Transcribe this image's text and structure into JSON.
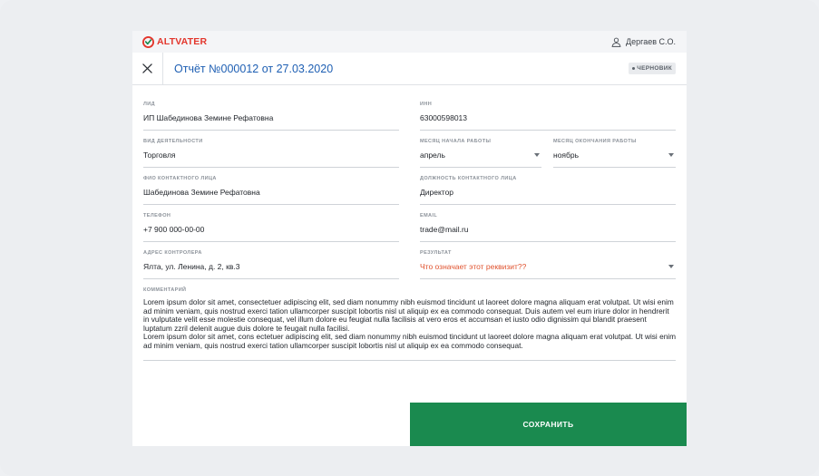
{
  "brand": {
    "name": "ALTVATER",
    "color": "#e3362c"
  },
  "user": {
    "name": "Дергаев С.О.",
    "icon": "user-icon"
  },
  "header": {
    "title": "Отчёт №000012 от 27.03.2020",
    "status_badge": "ЧЕРНОВИК",
    "close_icon": "close-icon"
  },
  "form": {
    "lid": {
      "label": "ЛИД",
      "value": "ИП Шабединова Земине Рефатовна"
    },
    "inn": {
      "label": "ИНН",
      "value": "63000598013"
    },
    "activity": {
      "label": "ВИД ДЕЯТЕЛЬНОСТИ",
      "value": "Торговля"
    },
    "start_month": {
      "label": "МЕСЯЦ НАЧАЛА РАБОТЫ",
      "value": "апрель"
    },
    "end_month": {
      "label": "МЕСЯЦ ОКОНЧАНИЯ РАБОТЫ",
      "value": "ноябрь"
    },
    "contact_name": {
      "label": "ФИО КОНТАКТНОГО ЛИЦА",
      "value": "Шабединова Земине Рефатовна"
    },
    "contact_position": {
      "label": "ДОЛЖНОСТЬ КОНТАКТНОГО ЛИЦА",
      "value": "Директор"
    },
    "phone": {
      "label": "ТЕЛЕФОН",
      "value": "+7 900 000-00-00"
    },
    "email": {
      "label": "EMAIL",
      "value": "trade@mail.ru"
    },
    "address": {
      "label": "АДРЕС КОНТРОЛЕРА",
      "value": "Ялта, ул. Ленина, д. 2, кв.3"
    },
    "result": {
      "label": "РЕЗУЛЬТАТ",
      "value": "Что означает этот реквизит??"
    },
    "comment": {
      "label": "КОММЕНТАРИЙ",
      "line1": "Lorem ipsum dolor sit amet, consectetuer adipiscing elit, sed diam nonummy nibh euismod tincidunt ut laoreet dolore magna aliquam erat volutpat. Ut wisi enim ad minim veniam, quis nostrud exerci tation ullamcorper suscipit lobortis nisl ut aliquip ex ea commodo consequat. Duis autem vel eum iriure dolor in hendrerit in vulputate velit esse molestie consequat, vel illum dolore eu feugiat nulla facilisis at vero eros et accumsan et iusto odio dignissim qui blandit praesent luptatum zzril delenit augue duis dolore te feugait nulla facilisi.",
      "line2": "Lorem ipsum dolor sit amet, cons ectetuer adipiscing elit, sed diam nonummy nibh euismod tincidunt ut laoreet dolore magna aliquam erat volutpat. Ut wisi enim ad minim veniam, quis nostrud exerci tation ullamcorper suscipit lobortis nisl ut aliquip ex ea commodo consequat."
    }
  },
  "actions": {
    "save_label": "СОХРАНИТЬ",
    "save_color": "#1a8a4f"
  }
}
